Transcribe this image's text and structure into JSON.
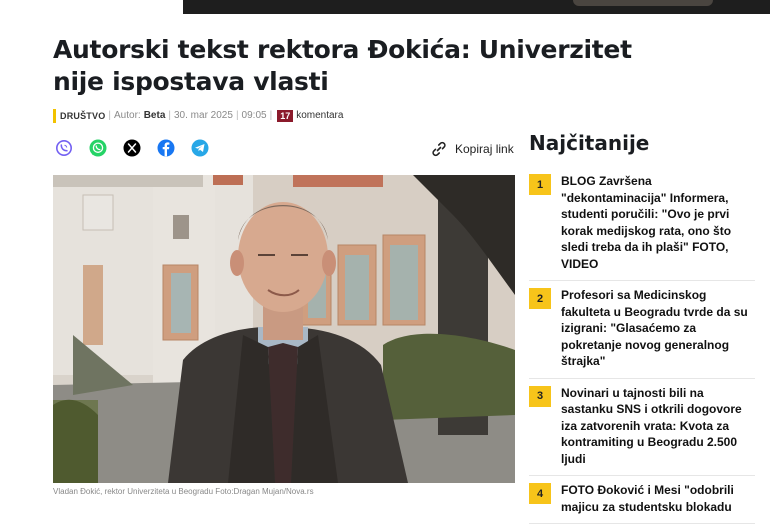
{
  "article": {
    "title": "Autorski tekst rektora Đokića: Univerzitet nije ispostava vlasti",
    "category": "DRUŠTVO",
    "author_prefix": "Autor:",
    "author": "Beta",
    "date": "30. mar 2025",
    "time": "09:05",
    "comments_count": "17",
    "comments_label": "komentara",
    "photo_caption": "Vladan Đokić, rektor Univerziteta u Beogradu Foto:Dragan Mujan/Nova.rs"
  },
  "share": {
    "icons": [
      "viber-icon",
      "whatsapp-icon",
      "x-icon",
      "facebook-icon",
      "telegram-icon"
    ],
    "copy_link_label": "Kopiraj link"
  },
  "sidebar": {
    "title": "Najčitanije",
    "items": [
      {
        "num": "1",
        "text": "BLOG Završena \"dekontaminacija\" Informera, studenti poručili: \"Ovo je prvi korak medijskog rata, ono što sledi treba da ih plaši\" FOTO, VIDEO"
      },
      {
        "num": "2",
        "text": "Profesori sa Medicinskog fakulteta u Beogradu tvrde da su izigrani: \"Glasaćemo za pokretanje novog generalnog štrajka\""
      },
      {
        "num": "3",
        "text": "Novinari u tajnosti bili na sastanku SNS i otkrili dogovore iza zatvorenih vrata: Kvota za kontramiting u Beogradu 2.500 ljudi"
      },
      {
        "num": "4",
        "text": "FOTO Đoković i Mesi \"odobrili majicu za studentsku blokadu"
      }
    ]
  },
  "colors": {
    "accent": "#f7c41a",
    "comment_badge": "#8b1a2b",
    "viber": "#7360f2",
    "whatsapp": "#25d366",
    "facebook": "#1877f2",
    "telegram": "#27a7e7"
  }
}
